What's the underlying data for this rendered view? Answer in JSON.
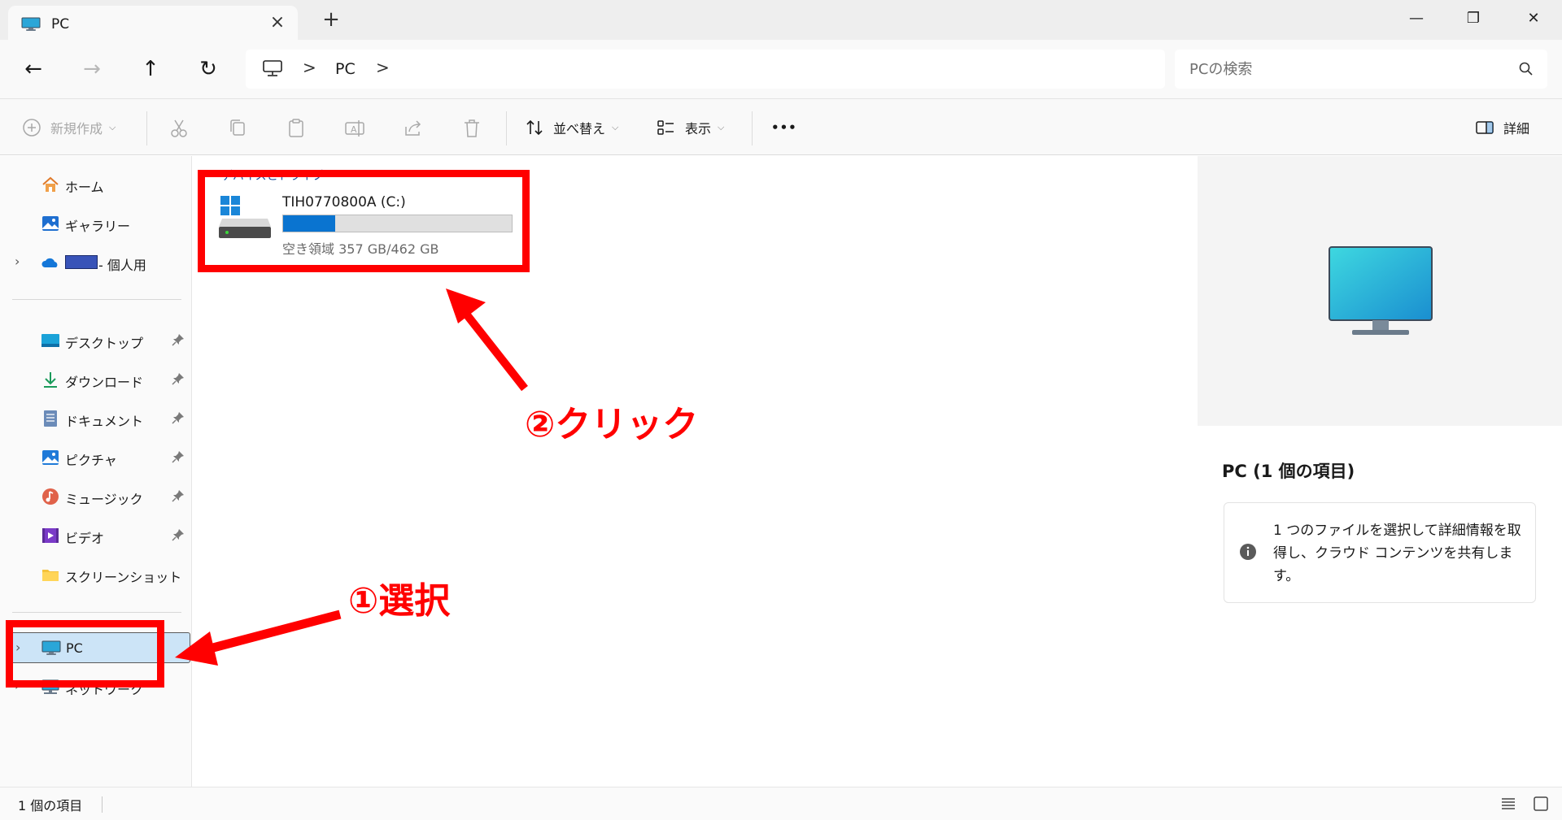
{
  "window": {
    "tab_title": "PC",
    "new_tab_label": "+",
    "minimize_label": "—",
    "maximize_label": "❐",
    "close_label": "✕"
  },
  "address": {
    "breadcrumb": [
      "PC"
    ],
    "separator": ">",
    "search_placeholder": "PCの検索"
  },
  "toolbar": {
    "new_label": "新規作成",
    "sort_label": "並べ替え",
    "view_label": "表示",
    "more_label": "•••",
    "details_label": "詳細"
  },
  "sidebar": {
    "quick": [
      {
        "label": "ホーム",
        "icon": "home-icon"
      },
      {
        "label": "ギャラリー",
        "icon": "gallery-icon"
      },
      {
        "label": "- 個人用",
        "icon": "onedrive-icon",
        "redacted": true
      }
    ],
    "pinned": [
      {
        "label": "デスクトップ",
        "icon": "desktop-icon",
        "pinned": true
      },
      {
        "label": "ダウンロード",
        "icon": "download-icon",
        "pinned": true
      },
      {
        "label": "ドキュメント",
        "icon": "documents-icon",
        "pinned": true
      },
      {
        "label": "ピクチャ",
        "icon": "pictures-icon",
        "pinned": true
      },
      {
        "label": "ミュージック",
        "icon": "music-icon",
        "pinned": true
      },
      {
        "label": "ビデオ",
        "icon": "videos-icon",
        "pinned": true
      },
      {
        "label": "スクリーンショット",
        "icon": "folder-icon",
        "pinned": false
      }
    ],
    "devices": [
      {
        "label": "PC",
        "icon": "pc-icon",
        "selected": true
      },
      {
        "label": "ネットワーク",
        "icon": "network-icon",
        "selected": false
      }
    ]
  },
  "content": {
    "group_header": "デバイスとドライブ",
    "drive": {
      "name": "TIH0770800A (C:)",
      "free_text": "空き領域 357 GB/462 GB",
      "used_fraction": 0.227
    }
  },
  "details": {
    "title": "PC (1 個の項目)",
    "message": "1 つのファイルを選択して詳細情報を取得し、クラウド コンテンツを共有します。"
  },
  "status": {
    "count": "1 個の項目"
  },
  "annotations": {
    "step1": "①選択",
    "step2": "②クリック",
    "color": "#ff0000"
  },
  "colors": {
    "accent": "#0a74d0",
    "selection": "#cce4f7"
  }
}
